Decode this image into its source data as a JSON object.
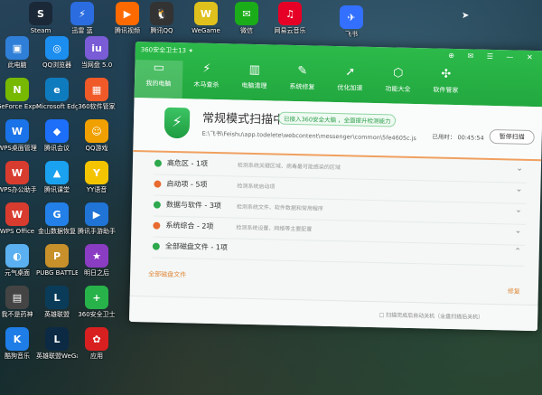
{
  "desktop": {
    "icons": [
      {
        "label": "Steam",
        "glyph": "S",
        "color": "#1b2838"
      },
      {
        "label": "迅雷 蓝",
        "glyph": "⚡",
        "color": "#2b6de0"
      },
      {
        "label": "腾讯视频",
        "glyph": "▶",
        "color": "#ff6a00"
      },
      {
        "label": "腾讯QQ",
        "glyph": "🐧",
        "color": "#333333"
      },
      {
        "label": "WeGame",
        "glyph": "W",
        "color": "#e0c01c"
      },
      {
        "label": "微信",
        "glyph": "✉",
        "color": "#1aad19"
      },
      {
        "label": "网易云音乐",
        "glyph": "♫",
        "color": "#e60026"
      },
      {
        "label": "飞书",
        "glyph": "✈",
        "color": "#3370ff"
      },
      {
        "label": "此电脑",
        "glyph": "▣",
        "color": "#2f7fd8"
      },
      {
        "label": "QQ浏览器",
        "glyph": "◎",
        "color": "#1c8ef0"
      },
      {
        "label": "当网盘 5.0",
        "glyph": "iu",
        "color": "#7a5cd6"
      },
      {
        "label": "GeForce Experience",
        "glyph": "N",
        "color": "#76b900"
      },
      {
        "label": "Microsoft Edge",
        "glyph": "e",
        "color": "#0f7bbf"
      },
      {
        "label": "360软件管家",
        "glyph": "▦",
        "color": "#f05a28"
      },
      {
        "label": "WPS桌面管理",
        "glyph": "W",
        "color": "#1a73e8"
      },
      {
        "label": "腾讯会议",
        "glyph": "◆",
        "color": "#1d6ffa"
      },
      {
        "label": "QQ游戏",
        "glyph": "☺",
        "color": "#f0a000"
      },
      {
        "label": "WPS办公助手",
        "glyph": "W",
        "color": "#d83c2f"
      },
      {
        "label": "腾讯课堂",
        "glyph": "▲",
        "color": "#1aa1f0"
      },
      {
        "label": "YY语音",
        "glyph": "Y",
        "color": "#f5c400"
      },
      {
        "label": "WPS Office",
        "glyph": "W",
        "color": "#d83c2f"
      },
      {
        "label": "金山数据恢复",
        "glyph": "G",
        "color": "#2280e8"
      },
      {
        "label": "腾讯手游助手",
        "glyph": "▶",
        "color": "#1f74d6"
      },
      {
        "label": "元气桌面",
        "glyph": "◐",
        "color": "#5ab0f0"
      },
      {
        "label": "PUBG BATTLEGROUND",
        "glyph": "P",
        "color": "#c7902b"
      },
      {
        "label": "明日之后",
        "glyph": "★",
        "color": "#8a3cc2"
      },
      {
        "label": "我不是药神",
        "glyph": "▤",
        "color": "#444444"
      },
      {
        "label": "英雄联盟",
        "glyph": "L",
        "color": "#0a3c5a"
      },
      {
        "label": "360安全卫士",
        "glyph": "+",
        "color": "#27b24a"
      },
      {
        "label": "酷狗音乐",
        "glyph": "K",
        "color": "#1f7de8"
      },
      {
        "label": "英雄联盟WeGame版",
        "glyph": "L",
        "color": "#0c2a44"
      },
      {
        "label": "应用",
        "glyph": "✿",
        "color": "#d82020"
      }
    ]
  },
  "window": {
    "title": "360安全卫士13 ✦",
    "controls": "⊕ ✉ ☰ — ✕",
    "nav": [
      {
        "label": "我的电脑",
        "glyph": "▭"
      },
      {
        "label": "木马查杀",
        "glyph": "⚡"
      },
      {
        "label": "电脑清理",
        "glyph": "▥"
      },
      {
        "label": "系统修复",
        "glyph": "✎"
      },
      {
        "label": "优化加速",
        "glyph": "➚"
      },
      {
        "label": "功能大全",
        "glyph": "⬡"
      },
      {
        "label": "软件管家",
        "glyph": "✣"
      }
    ],
    "scan": {
      "title": "常规模式扫描中",
      "badge": "已接入360安全大脑 ，全面提升检测能力",
      "path": "E:\\飞书\\Feishu\\app.todelete\\webcontent\\messenger\\common\\5fe4605c.js",
      "elapsed": "已用时： 00:45:54",
      "pause": "暂停扫描"
    },
    "rows": [
      {
        "title": "高危区 - 1项",
        "desc": "检测系统关键区域、病毒最可能感染的区域",
        "color": "#2ea84c",
        "chev": "⌄"
      },
      {
        "title": "启动项 - 5项",
        "desc": "检测系统启动项",
        "color": "#e86a30",
        "chev": "⌄"
      },
      {
        "title": "数据与软件 - 3项",
        "desc": "检测系统文件、软件数据和常用程序",
        "color": "#2ea84c",
        "chev": "⌄"
      },
      {
        "title": "系统综合 - 2项",
        "desc": "检测系统设置、网络等主要配置",
        "color": "#e86a30",
        "chev": "⌄"
      },
      {
        "title": "全部磁盘文件 - 1项",
        "desc": "",
        "color": "#2ea84c",
        "chev": "⌃"
      }
    ],
    "sub_label": "全部磁盘文件",
    "right_note": "修复",
    "bottom_check": "□ 扫描完成后自动关机（全盘扫描后关机）"
  }
}
